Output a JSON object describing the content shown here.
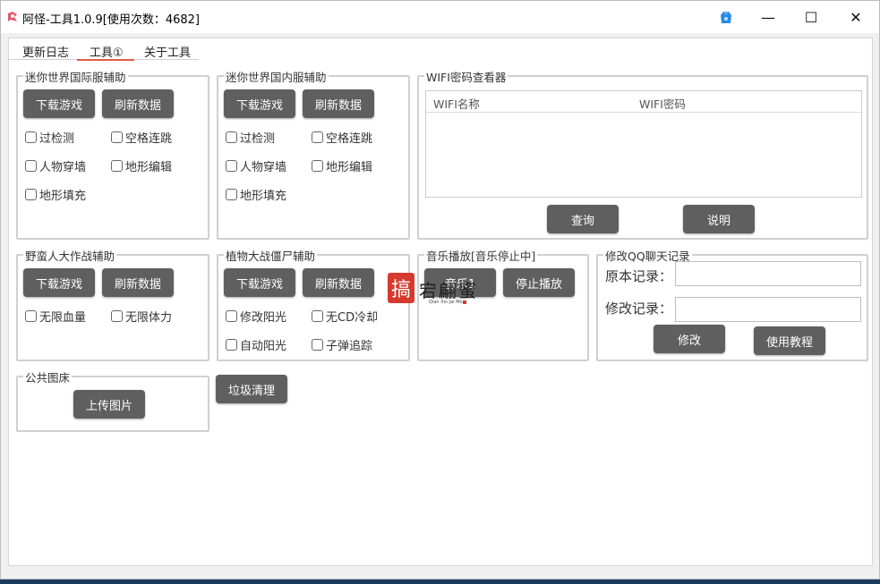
{
  "window": {
    "title": "阿怪-工具1.0.9[使用次数：4682]",
    "controls": {
      "minimize": "—",
      "maximize": "☐",
      "close": "✕"
    }
  },
  "tabs": [
    {
      "label": "更新日志",
      "active": false
    },
    {
      "label": "工具①",
      "active": true
    },
    {
      "label": "关于工具",
      "active": false
    }
  ],
  "groups": {
    "mini_intl": {
      "title": "迷你世界国际服辅助",
      "buttons": [
        "下载游戏",
        "刷新数据"
      ],
      "checkboxes": [
        "过检测",
        "空格连跳",
        "人物穿墙",
        "地形编辑",
        "地形填充"
      ]
    },
    "mini_cn": {
      "title": "迷你世界国内服辅助",
      "buttons": [
        "下载游戏",
        "刷新数据"
      ],
      "checkboxes": [
        "过检测",
        "空格连跳",
        "人物穿墙",
        "地形编辑",
        "地形填充"
      ]
    },
    "wifi": {
      "title": "WIFI密码查看器",
      "columns": [
        "WIFI名称",
        "WIFI密码"
      ],
      "buttons": [
        "查询",
        "说明"
      ]
    },
    "savage": {
      "title": "野蛮人大作战辅助",
      "buttons": [
        "下载游戏",
        "刷新数据"
      ],
      "checkboxes": [
        "无限血量",
        "无限体力"
      ]
    },
    "pvz": {
      "title": "植物大战僵尸辅助",
      "buttons": [
        "下载游戏",
        "刷新数据"
      ],
      "checkboxes": [
        "修改阳光",
        "无CD冷却",
        "自动阳光",
        "子弹追踪"
      ]
    },
    "music": {
      "title": "音乐播放[音乐停止中]",
      "buttons": [
        "音乐1",
        "停止播放"
      ]
    },
    "qq": {
      "title": "修改QQ聊天记录",
      "original_label": "原本记录：",
      "modified_label": "修改记录：",
      "original_value": "",
      "modified_value": "",
      "buttons": [
        "修改",
        "使用教程"
      ]
    },
    "imagebed": {
      "title": "公共图床",
      "buttons": [
        "上传图片"
      ]
    }
  },
  "standalone_button": "垃圾清理",
  "colors": {
    "button": "#5f5f5f",
    "tab_underline": "#e15a48",
    "watermark_red": "#d63a2d"
  },
  "watermark": {
    "seal_char": "搞",
    "text": "宕翩蜜",
    "subtext": "Qian Xin Jai Mo"
  }
}
